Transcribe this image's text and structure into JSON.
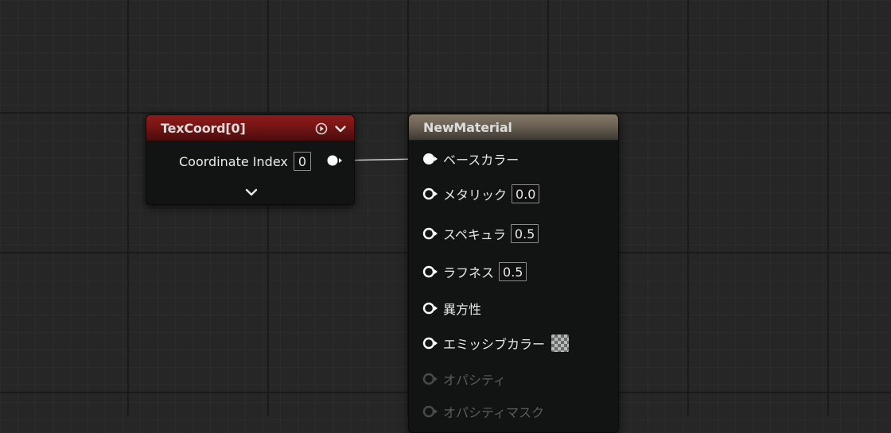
{
  "texcoord_node": {
    "title": "TexCoord[0]",
    "coordinate_index_label": "Coordinate Index",
    "coordinate_index_value": "0",
    "icons": {
      "preview": "play-circle-icon",
      "collapse": "chevron-down-icon",
      "expand": "chevron-down-icon"
    },
    "header_color": "#7a1515"
  },
  "material_node": {
    "title": "NewMaterial",
    "header_color": "#6b6154",
    "inputs": [
      {
        "label": "ベースカラー",
        "value": "",
        "connected": true,
        "enabled": true
      },
      {
        "label": "メタリック",
        "value": "0.0",
        "connected": false,
        "enabled": true
      },
      {
        "label": "スペキュラ",
        "value": "0.5",
        "connected": false,
        "enabled": true
      },
      {
        "label": "ラフネス",
        "value": "0.5",
        "connected": false,
        "enabled": true
      },
      {
        "label": "異方性",
        "value": "",
        "connected": false,
        "enabled": true
      },
      {
        "label": "エミッシブカラー",
        "value": "",
        "connected": false,
        "enabled": true,
        "swatch": "checker"
      },
      {
        "label": "オパシティ",
        "value": "",
        "connected": false,
        "enabled": false
      },
      {
        "label": "オパシティマスク",
        "value": "",
        "connected": false,
        "enabled": false
      }
    ]
  },
  "colors": {
    "graph_background": "#262626",
    "wire": "#d0d0d0",
    "pin_active": "#ffffff",
    "pin_disabled": "#4a4a4a"
  }
}
